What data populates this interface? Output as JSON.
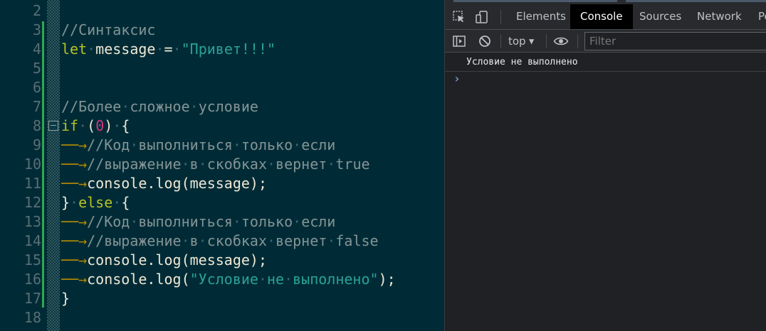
{
  "editor": {
    "line_numbers": [
      "2",
      "3",
      "4",
      "5",
      "6",
      "7",
      "8",
      "9",
      "10",
      "11",
      "12",
      "13",
      "14",
      "15",
      "16",
      "17",
      "18"
    ],
    "lines": {
      "l3": "//Синтаксис",
      "l4_kw": "let",
      "l4_var": "message",
      "l4_op": "=",
      "l4_str": "\"Привет!!!\"",
      "l7": "//Более сложное условие",
      "l8_kw": "if",
      "l8_open": "(",
      "l8_num": "0",
      "l8_close": ")",
      "l8_brace": "{",
      "l9": "//Код выполниться только если",
      "l10": "//выражение в скобках вернет true",
      "l11": "console.log(message);",
      "l12_close": "}",
      "l12_kw": "else",
      "l12_brace": "{",
      "l13": "//Код выполниться только если",
      "l14": "//выражение в скобках вернет false",
      "l15": "console.log(message);",
      "l16_pre": "console.log(",
      "l16_str": "\"Условие не выполнено\"",
      "l16_post": ");",
      "l17": "}"
    }
  },
  "devtools": {
    "tabs": [
      "Elements",
      "Console",
      "Sources",
      "Network",
      "Pe"
    ],
    "active_tab": "Console",
    "context": "top",
    "filter_placeholder": "Filter",
    "console_message": "Условие не выполнено",
    "prompt_symbol": "›"
  },
  "colors": {
    "editor_bg": "#002b36",
    "keyword": "#b5c223",
    "string": "#2aa198",
    "number": "#d33682",
    "comment": "#839496",
    "devtools_bg": "#202124",
    "change_bar": "#2fa84f"
  },
  "icons": [
    "inspect-element-icon",
    "device-toolbar-icon",
    "sidebar-toggle-icon",
    "clear-console-icon",
    "eye-icon",
    "dropdown-caret-icon"
  ]
}
